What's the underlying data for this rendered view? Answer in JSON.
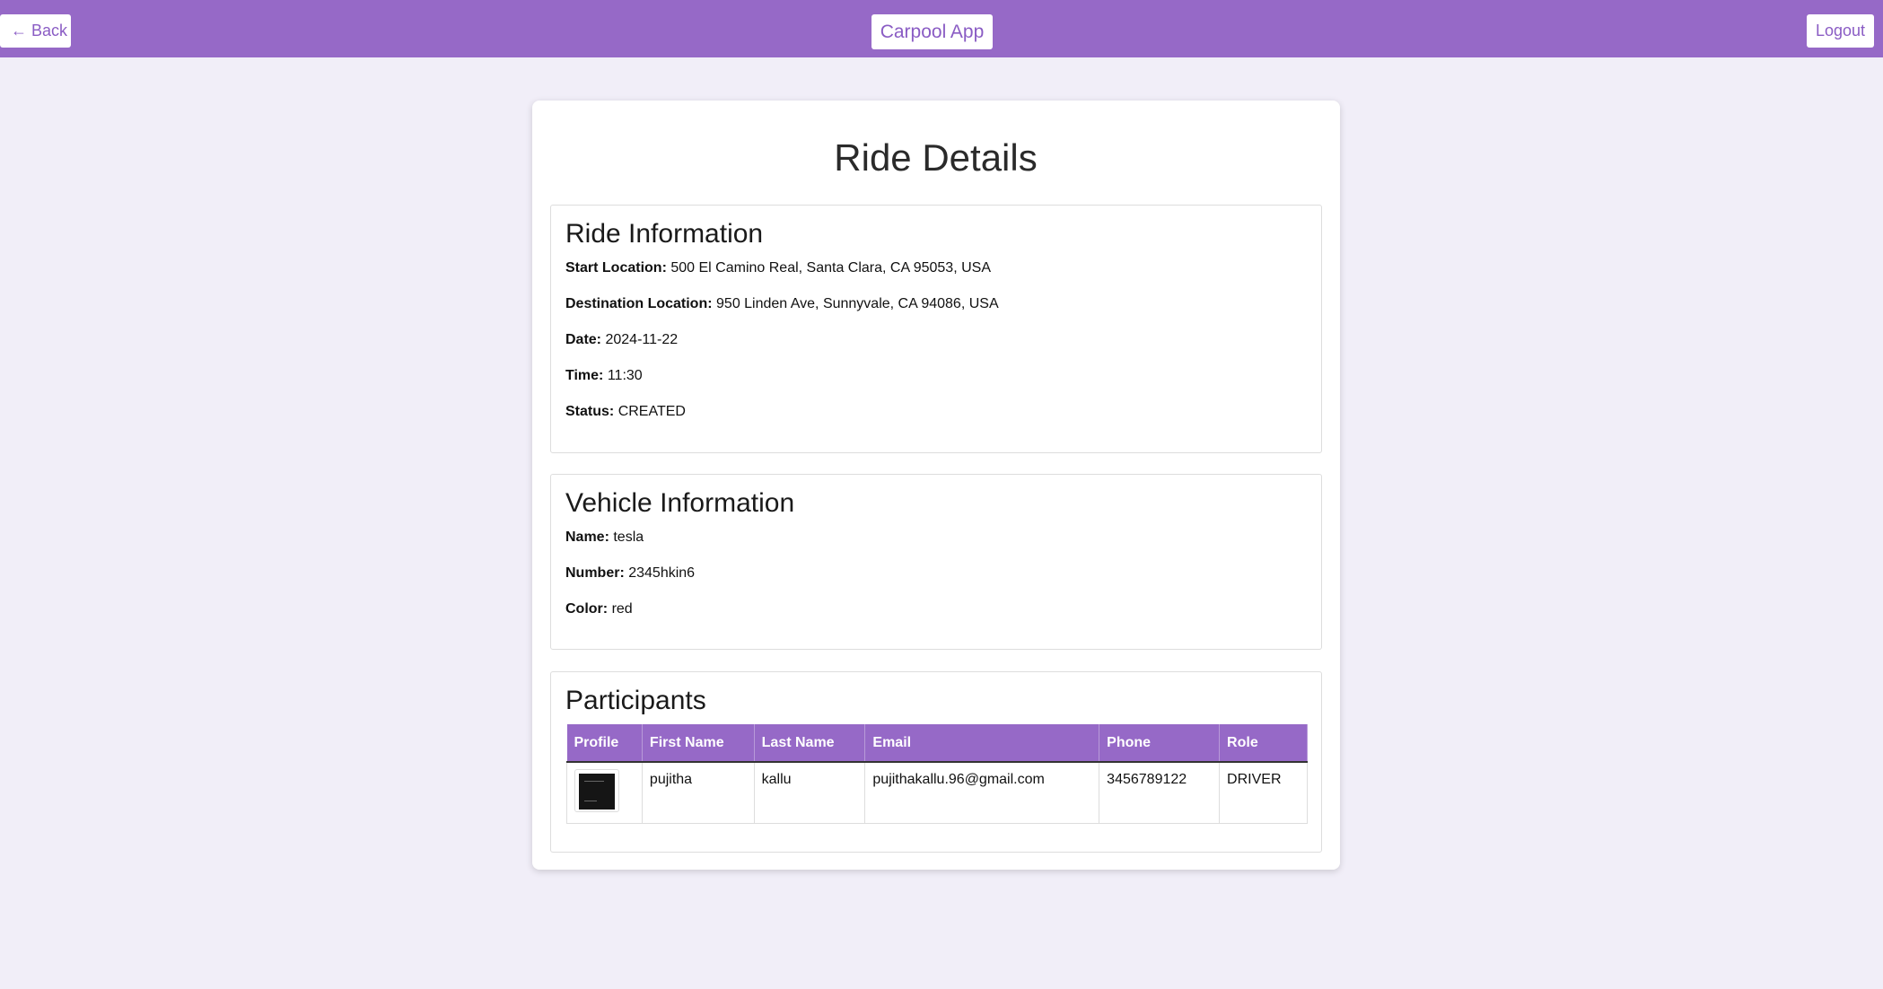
{
  "nav": {
    "back_label": "Back",
    "back_icon": "arrow-left-icon",
    "app_title": "Carpool App",
    "logout_label": "Logout"
  },
  "page": {
    "title": "Ride Details"
  },
  "ride": {
    "heading": "Ride Information",
    "fields": [
      {
        "label": "Start Location:",
        "value": "500 El Camino Real, Santa Clara, CA 95053, USA"
      },
      {
        "label": "Destination Location:",
        "value": "950 Linden Ave, Sunnyvale, CA 94086, USA"
      },
      {
        "label": "Date:",
        "value": "2024-11-22"
      },
      {
        "label": "Time:",
        "value": "11:30"
      },
      {
        "label": "Status:",
        "value": "CREATED"
      }
    ]
  },
  "vehicle": {
    "heading": "Vehicle Information",
    "fields": [
      {
        "label": "Name:",
        "value": "tesla"
      },
      {
        "label": "Number:",
        "value": "2345hkin6"
      },
      {
        "label": "Color:",
        "value": "red"
      }
    ]
  },
  "participants": {
    "heading": "Participants",
    "columns": [
      "Profile",
      "First Name",
      "Last Name",
      "Email",
      "Phone",
      "Role"
    ],
    "rows": [
      {
        "first_name": "pujitha",
        "last_name": "kallu",
        "email": "pujithakallu.96@gmail.com",
        "phone": "3456789122",
        "role": "DRIVER"
      }
    ]
  },
  "colors": {
    "accent": "#9669c7",
    "background": "#f1eef8",
    "button_text": "#8a5cc4"
  }
}
